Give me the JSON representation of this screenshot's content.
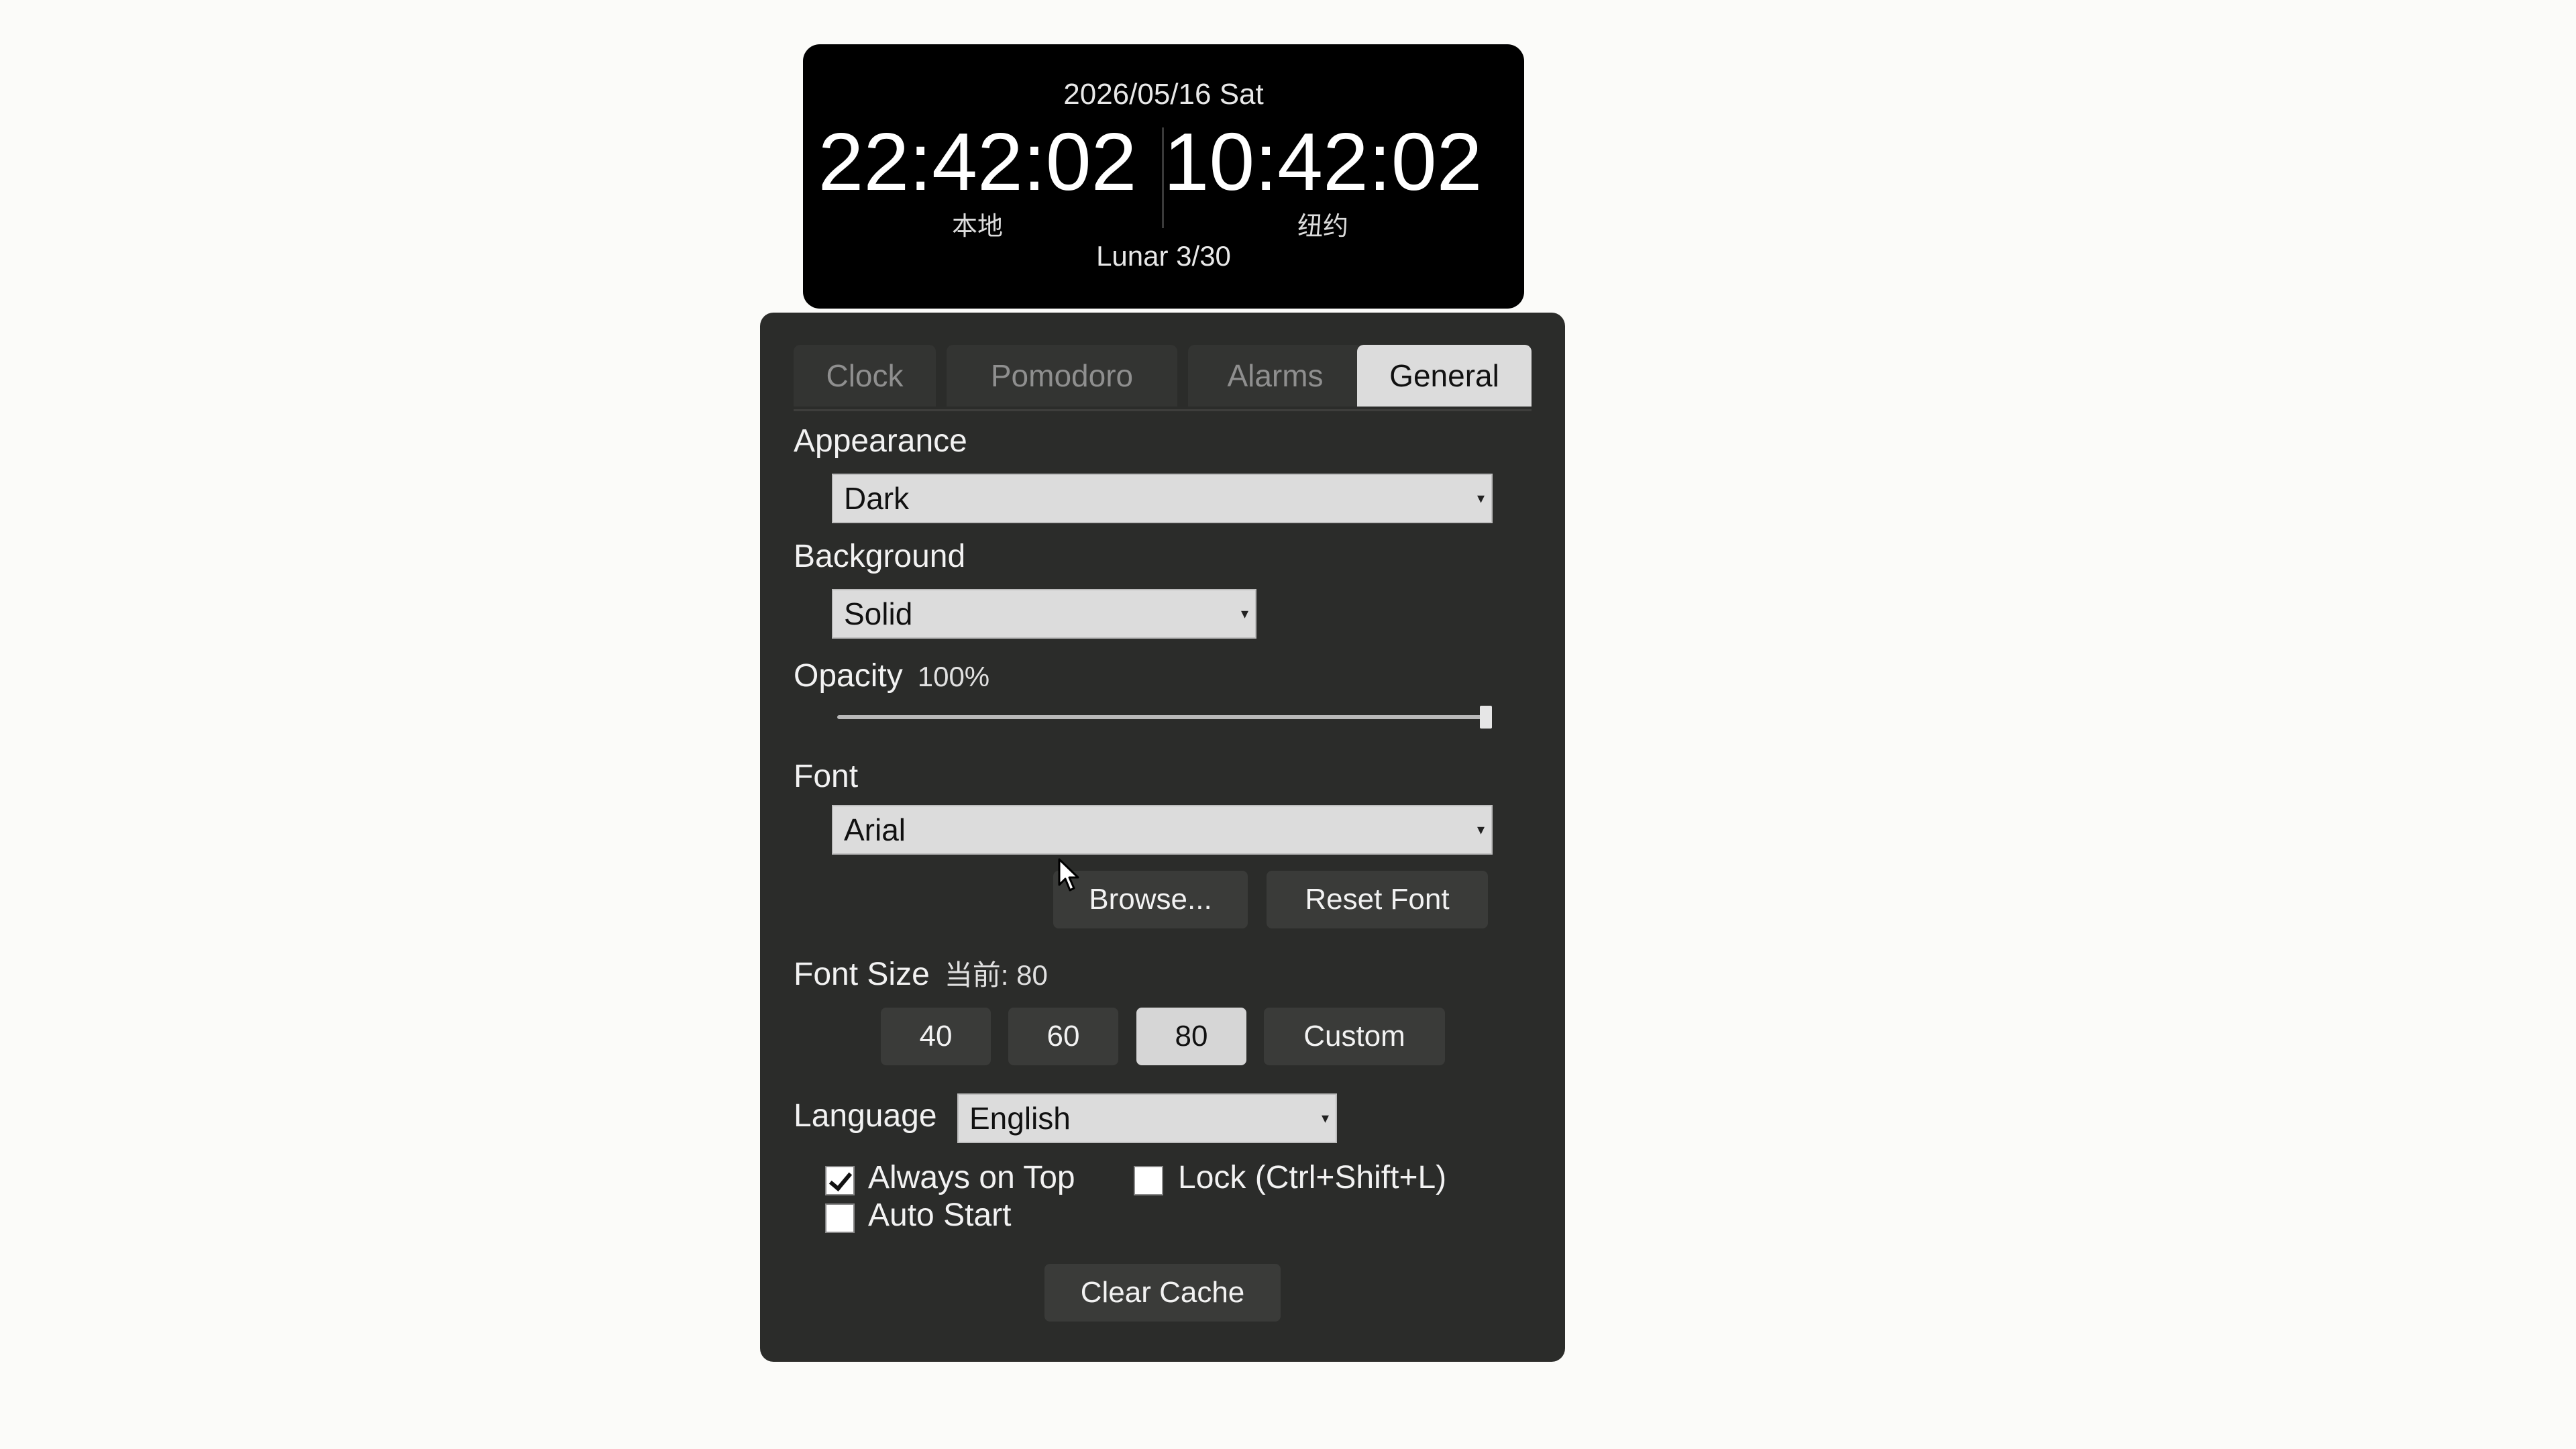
{
  "clock": {
    "date": "2026/05/16 Sat",
    "local_time": "22:42:02",
    "local_label": "本地",
    "remote_time": "10:42:02",
    "remote_label": "纽约",
    "lunar": "Lunar 3/30"
  },
  "tabs": [
    {
      "label": "Clock",
      "active": false
    },
    {
      "label": "Pomodoro",
      "active": false
    },
    {
      "label": "Alarms",
      "active": false
    },
    {
      "label": "General",
      "active": true
    }
  ],
  "general": {
    "appearance": {
      "label": "Appearance",
      "value": "Dark"
    },
    "background": {
      "label": "Background",
      "value": "Solid"
    },
    "opacity": {
      "label": "Opacity",
      "value_text": "100%",
      "value": 1.0
    },
    "font": {
      "label": "Font",
      "value": "Arial",
      "browse_label": "Browse...",
      "reset_label": "Reset Font"
    },
    "font_size": {
      "label": "Font Size",
      "current_text": "当前: 80",
      "options": [
        "40",
        "60",
        "80",
        "Custom"
      ],
      "selected": "80"
    },
    "language": {
      "label": "Language",
      "value": "English"
    },
    "checkboxes": {
      "always_on_top": {
        "label": "Always on Top",
        "checked": true
      },
      "lock": {
        "label": "Lock (Ctrl+Shift+L)",
        "checked": false
      },
      "auto_start": {
        "label": "Auto Start",
        "checked": false
      }
    },
    "clear_cache_label": "Clear Cache"
  },
  "icons": {
    "dropdown": "chevron-down-icon",
    "cursor": "mouse-pointer-icon"
  }
}
